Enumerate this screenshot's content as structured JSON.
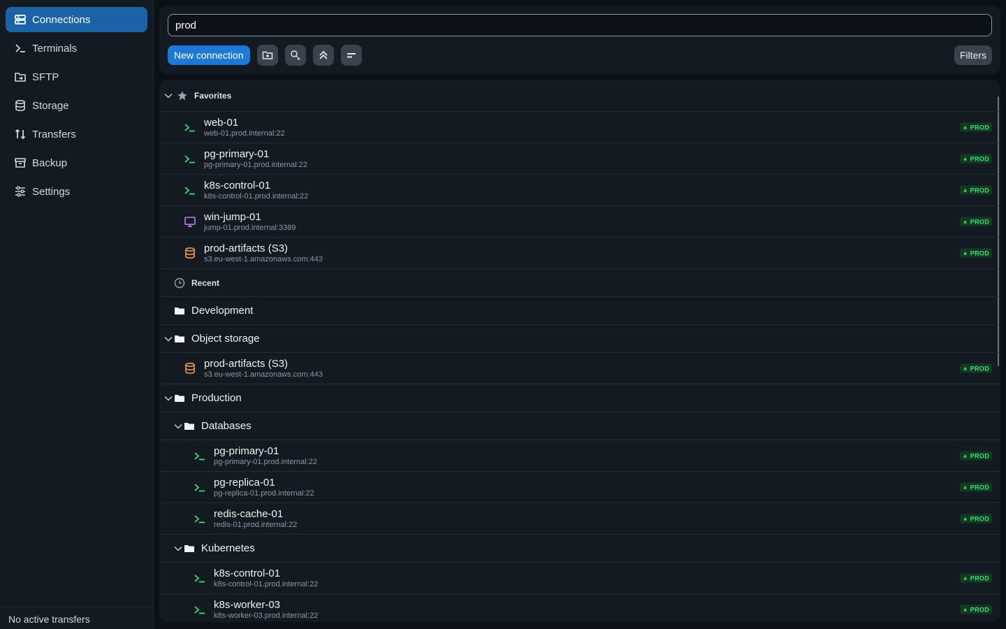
{
  "sidebar": {
    "items": [
      {
        "label": "Connections",
        "icon": "connections-icon",
        "active": true
      },
      {
        "label": "Terminals",
        "icon": "terminal-icon"
      },
      {
        "label": "SFTP",
        "icon": "sftp-folder-icon"
      },
      {
        "label": "Storage",
        "icon": "database-icon"
      },
      {
        "label": "Transfers",
        "icon": "transfer-arrows-icon"
      },
      {
        "label": "Backup",
        "icon": "archive-icon"
      },
      {
        "label": "Settings",
        "icon": "sliders-icon"
      }
    ],
    "footer": "No active transfers"
  },
  "toolbar": {
    "search_value": "prod",
    "new_connection": "New connection",
    "filters": "Filters",
    "icon_buttons": [
      "new-folder-icon",
      "clear-search-icon",
      "collapse-all-icon",
      "sort-icon"
    ]
  },
  "list": {
    "favorites_label": "Favorites",
    "recent_label": "Recent",
    "favorites": [
      {
        "name": "web-01",
        "host": "web-01.prod.internal:22",
        "type": "ssh",
        "badge": "PROD"
      },
      {
        "name": "pg-primary-01",
        "host": "pg-primary-01.prod.internal:22",
        "type": "ssh",
        "badge": "PROD"
      },
      {
        "name": "k8s-control-01",
        "host": "k8s-control-01.prod.internal:22",
        "type": "ssh",
        "badge": "PROD"
      },
      {
        "name": "win-jump-01",
        "host": "jump-01.prod.internal:3389",
        "type": "rdp",
        "badge": "PROD"
      },
      {
        "name": "prod-artifacts (S3)",
        "host": "s3.eu-west-1.amazonaws.com:443",
        "type": "s3",
        "badge": "PROD"
      }
    ],
    "groups": {
      "development": "Development",
      "object_storage": "Object storage",
      "production": "Production",
      "databases": "Databases",
      "kubernetes": "Kubernetes"
    },
    "object_storage_items": [
      {
        "name": "prod-artifacts (S3)",
        "host": "s3.eu-west-1.amazonaws.com:443",
        "type": "s3",
        "badge": "PROD"
      }
    ],
    "database_items": [
      {
        "name": "pg-primary-01",
        "host": "pg-primary-01.prod.internal:22",
        "type": "ssh",
        "badge": "PROD"
      },
      {
        "name": "pg-replica-01",
        "host": "pg-replica-01.prod.internal:22",
        "type": "ssh",
        "badge": "PROD"
      },
      {
        "name": "redis-cache-01",
        "host": "redis-01.prod.internal:22",
        "type": "ssh",
        "badge": "PROD"
      }
    ],
    "kubernetes_items": [
      {
        "name": "k8s-control-01",
        "host": "k8s-control-01.prod.internal:22",
        "type": "ssh",
        "badge": "PROD"
      },
      {
        "name": "k8s-worker-03",
        "host": "k8s-worker-03.prod.internal:22",
        "type": "ssh",
        "badge": "PROD"
      }
    ]
  },
  "colors": {
    "accent": "#1c7ad6",
    "active_nav": "#1b62a6",
    "ssh_icon": "#3ddc74",
    "rdp_icon": "#b784f5",
    "s3_icon": "#f0a04b",
    "badge_text": "#3ddc74",
    "badge_bg": "#123a22"
  }
}
